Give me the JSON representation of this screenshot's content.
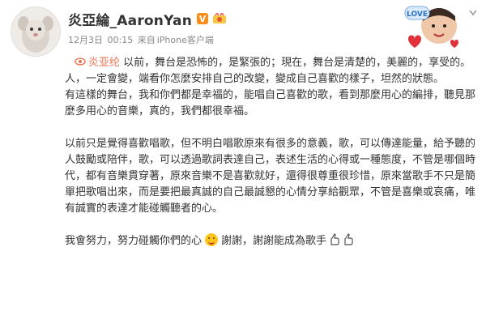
{
  "user": {
    "name": "炎亞綸_AaronYan",
    "verified_mark": "V",
    "verified_color": "#ff8c16",
    "badge_icon": "medal-icon"
  },
  "meta": {
    "date": "12月3日",
    "time": "00:15",
    "source_prefix": "来自",
    "source": "iPhone客户端"
  },
  "post": {
    "mention": "炎亚纶",
    "mention_color": "#eb7350",
    "para1_after_mention": "以前，舞台是恐怖的，是緊張的；現在，舞台是清楚的，美麗的，享受的。",
    "para2": "人，一定會變，端看你怎麼安排自己的改變，變成自己喜歡的樣子，坦然的狀態。",
    "para3": "有這樣的舞台，我和你們都是幸福的，能唱自己喜歡的歌，看到那麼用心的編排，聽見那麼多用心的音樂，真的，我們都很幸福。",
    "para4": "以前只是覺得喜歡唱歌，但不明白唱歌原來有很多的意義，歌，可以傳達能量，給予聽的人鼓勵或陪伴，歌，可以透過歌詞表達自己，表述生活的心得或一種態度，不管是哪個時代，都有音樂貫穿著，原來音樂不是喜歡就好，還得很尊重很珍惜，原來當歌手不只是簡單把歌唱出來，而是要把最真誠的自己最誠懇的心情分享給觀眾，不管是喜樂或哀痛，唯有誠實的表達才能碰觸聽者的心。",
    "para5_a": "我會努力，努力碰觸你們的心",
    "para5_b": "謝謝，謝謝能成為歌手"
  },
  "sticker": {
    "text": "LOVE"
  }
}
